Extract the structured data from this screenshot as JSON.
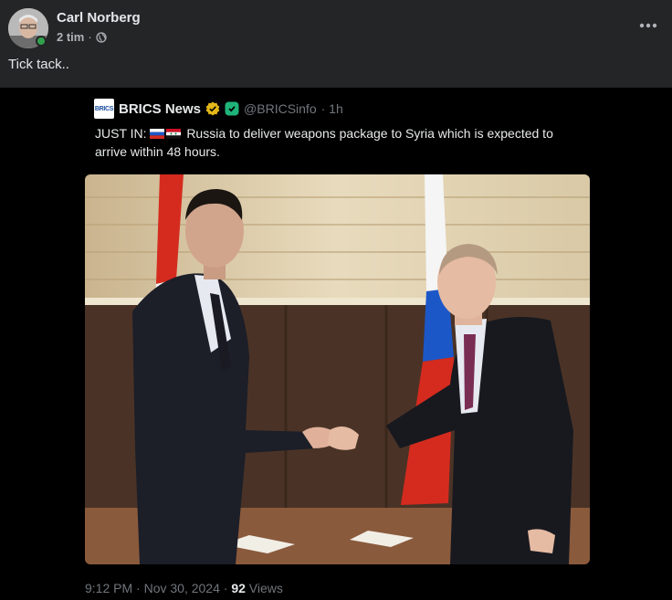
{
  "post": {
    "author": "Carl Norberg",
    "time": "2 tim",
    "separator": "·",
    "caption": "Tick tack.."
  },
  "tweet": {
    "logo_text": "BRICS",
    "name": "BRICS News",
    "handle": "@BRICSinfo",
    "age": "· 1h",
    "text_prefix": "JUST IN:",
    "text": "Russia to deliver weapons package to Syria which is expected to arrive within 48 hours.",
    "timestamp": "9:12 PM · Nov 30, 2024 · ",
    "views_count": "92",
    "views_label": " Views"
  },
  "colors": {
    "header_bg": "#242526",
    "verified": "#e2b719",
    "online": "#31a24c"
  },
  "icons": [
    "globe-icon",
    "more-options-icon",
    "verified-badge-icon",
    "affiliate-icon"
  ]
}
